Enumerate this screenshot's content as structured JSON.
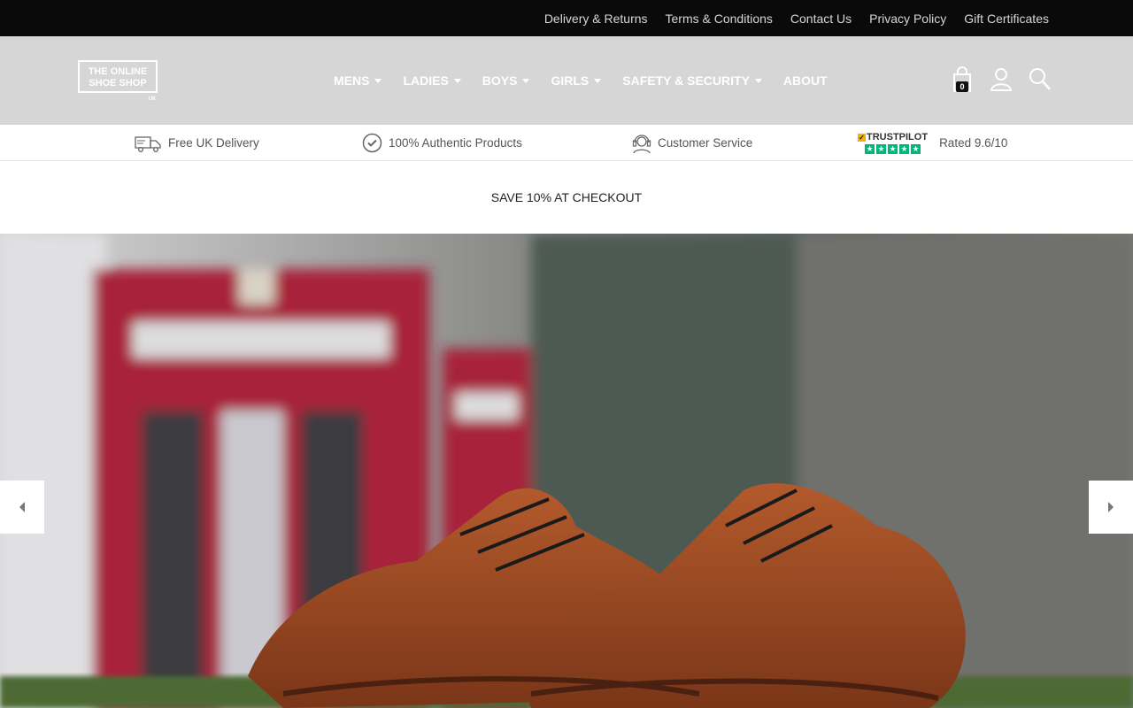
{
  "topbar": {
    "links": [
      "Delivery & Returns",
      "Terms & Conditions",
      "Contact Us",
      "Privacy Policy",
      "Gift Certificates"
    ]
  },
  "header": {
    "logo_line1": "THE ONLINE",
    "logo_line2": "SHOE SHOP",
    "logo_suffix": "UK",
    "nav": [
      {
        "label": "MENS",
        "dropdown": true
      },
      {
        "label": "LADIES",
        "dropdown": true
      },
      {
        "label": "BOYS",
        "dropdown": true
      },
      {
        "label": "GIRLS",
        "dropdown": true
      },
      {
        "label": "SAFETY & SECURITY",
        "dropdown": true
      },
      {
        "label": "ABOUT",
        "dropdown": false
      }
    ],
    "cart_count": "0",
    "icons": [
      "bag-icon",
      "user-icon",
      "search-icon"
    ]
  },
  "usp": {
    "delivery": "Free UK Delivery",
    "authentic": "100% Authentic Products",
    "service": "Customer Service",
    "trustpilot_brand": "TRUSTPILOT",
    "rating": "Rated 9.6/10"
  },
  "promo": {
    "text": "SAVE 10% AT CHECKOUT"
  },
  "colors": {
    "topbar_bg": "#0a0a0a",
    "header_bg": "#d6d6d6",
    "trustpilot_green": "#00b67a",
    "phone_box_red": "#b5253a",
    "shoe_brown": "#9a4a22"
  }
}
